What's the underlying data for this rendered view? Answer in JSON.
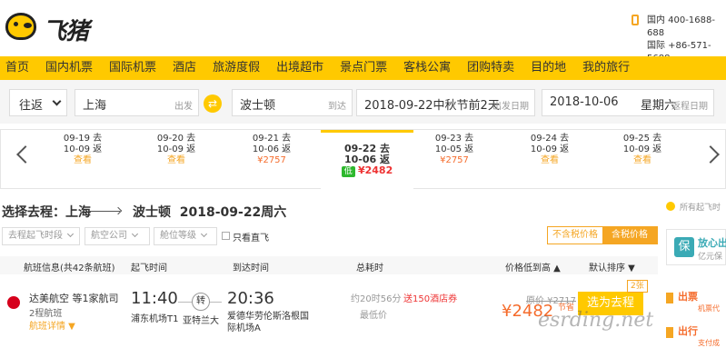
{
  "header": {
    "logo_text": "飞猪",
    "hotline_domestic": "国内 400-1688-688",
    "hotline_international": "国际 +86-571-5688"
  },
  "nav": [
    "首页",
    "国内机票",
    "国际机票",
    "酒店",
    "旅游度假",
    "出境超市",
    "景点门票",
    "客栈公寓",
    "团购特卖",
    "目的地",
    "我的旅行"
  ],
  "search": {
    "trip_type": "往返",
    "from_city": "上海",
    "from_hint": "出发",
    "swap_symbol": "⇄",
    "to_city": "波士顿",
    "to_hint": "到达",
    "depart_date": "2018-09-22中秋节前2天",
    "depart_hint": "出发日期",
    "return_date": "2018-10-06",
    "return_weekday": "星期六",
    "return_hint": "返程日期"
  },
  "date_strip": [
    {
      "go": "09-19 去",
      "back": "10-09 返",
      "action": "查看"
    },
    {
      "go": "09-20 去",
      "back": "10-09 返",
      "action": "查看"
    },
    {
      "go": "09-21 去",
      "back": "10-06 返",
      "price": "¥2757"
    },
    {
      "go": "09-22 去",
      "back": "10-06 返",
      "low": "低",
      "price": "¥2482",
      "selected": true
    },
    {
      "go": "09-23 去",
      "back": "10-05 返",
      "price": "¥2757"
    },
    {
      "go": "09-24 去",
      "back": "10-09 返",
      "action": "查看"
    },
    {
      "go": "09-25 去",
      "back": "10-09 返",
      "action": "查看"
    }
  ],
  "selection": {
    "label": "选择去程：上海",
    "to": "波士顿",
    "date": "2018-09-22周六"
  },
  "filters": {
    "time": "去程起飞时段",
    "airline": "航空公司",
    "cabin": "舱位等级",
    "direct_only": "只看直飞"
  },
  "price_tabs": {
    "excl_tax": "不含税价格",
    "incl_tax": "含税价格"
  },
  "columns": {
    "info": "航班信息(共42条航班)",
    "depart": "起飞时间",
    "arrive": "到达时间",
    "duration": "总耗时",
    "price": "价格低到高 ▲",
    "sort": "默认排序 ▼"
  },
  "flight": {
    "airline": "达美航空 等1家航司",
    "legs": "2程航班",
    "detail": "航班详情 ▼",
    "depart_time": "11:40",
    "depart_airport": "浦东机场T1",
    "transfer": "转",
    "via": "亚特兰大",
    "arrive_time": "20:36",
    "arrive_airport": "爱德华劳伦斯洛根国际机场A",
    "duration": "约20时56分",
    "duration_note": "最低价",
    "coupon": "送150酒店券",
    "original_price": "原价 ¥2717",
    "price": "¥2482",
    "price_note": "节省",
    "select": "选为去程",
    "count_badge": "2张"
  },
  "sidebar": {
    "notice": "所有起飞时",
    "guarantee_icon": "保",
    "guarantee_title": "放心出",
    "guarantee_sub": "亿元保",
    "item1": "出票",
    "item1_sub": "机票代",
    "item2": "出行",
    "item2_sub": "支付成"
  },
  "watermark": "esrding.net"
}
